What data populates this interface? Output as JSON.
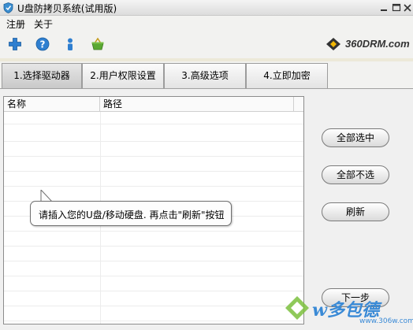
{
  "window": {
    "title": "U盘防拷贝系统(试用版)",
    "controls": [
      "minimize",
      "maximize",
      "close"
    ]
  },
  "menu": {
    "items": [
      "注册",
      "关于"
    ]
  },
  "toolbar": {
    "icons": [
      "plus-icon",
      "help-icon",
      "user-icon",
      "basket-icon"
    ]
  },
  "brand": {
    "text": "360DRM.com"
  },
  "tabs": [
    {
      "label": "1.选择驱动器",
      "active": true
    },
    {
      "label": "2.用户权限设置",
      "active": false
    },
    {
      "label": "3.高级选项",
      "active": false
    },
    {
      "label": "4.立即加密",
      "active": false
    }
  ],
  "list": {
    "columns": [
      "名称",
      "路径"
    ],
    "rows": []
  },
  "buttons": {
    "select_all": "全部选中",
    "select_none": "全部不选",
    "refresh": "刷新",
    "next": "下一步"
  },
  "tooltip": {
    "text": "请插入您的U盘/移动硬盘. 再点击\"刷新\"按钮"
  },
  "watermark": {
    "text": "w多包德",
    "sub": "www.306w.com"
  },
  "colors": {
    "tab_active": "#cfcfcf",
    "watermark": "#3a8ad6",
    "brand_icon": "#f2b705"
  }
}
